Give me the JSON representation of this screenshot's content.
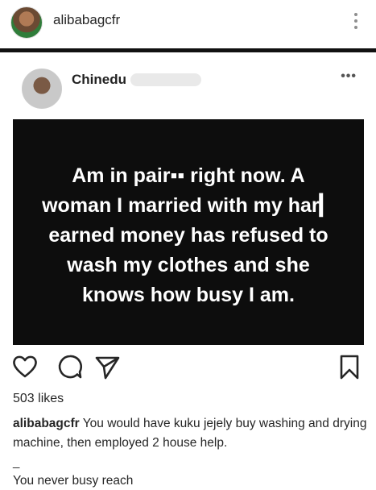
{
  "header": {
    "username": "alibabagcfr",
    "more_icon": "more-vertical-icon"
  },
  "embedded_post": {
    "author_name": "Chinedu",
    "more_label": "•••",
    "image_text": "Am in pair▪▪ right now. A woman I married with my har▎ earned money has refused to wash my clothes and she knows how busy I am."
  },
  "actions": {
    "like_icon": "heart-icon",
    "comment_icon": "comment-icon",
    "share_icon": "send-icon",
    "save_icon": "bookmark-icon"
  },
  "likes": "503 likes",
  "caption": {
    "user": "alibabagcfr",
    "text": " You would have kuku jejely buy washing and drying machine, then employed 2 house help.",
    "dash": "_",
    "line2": "You never busy reach"
  }
}
